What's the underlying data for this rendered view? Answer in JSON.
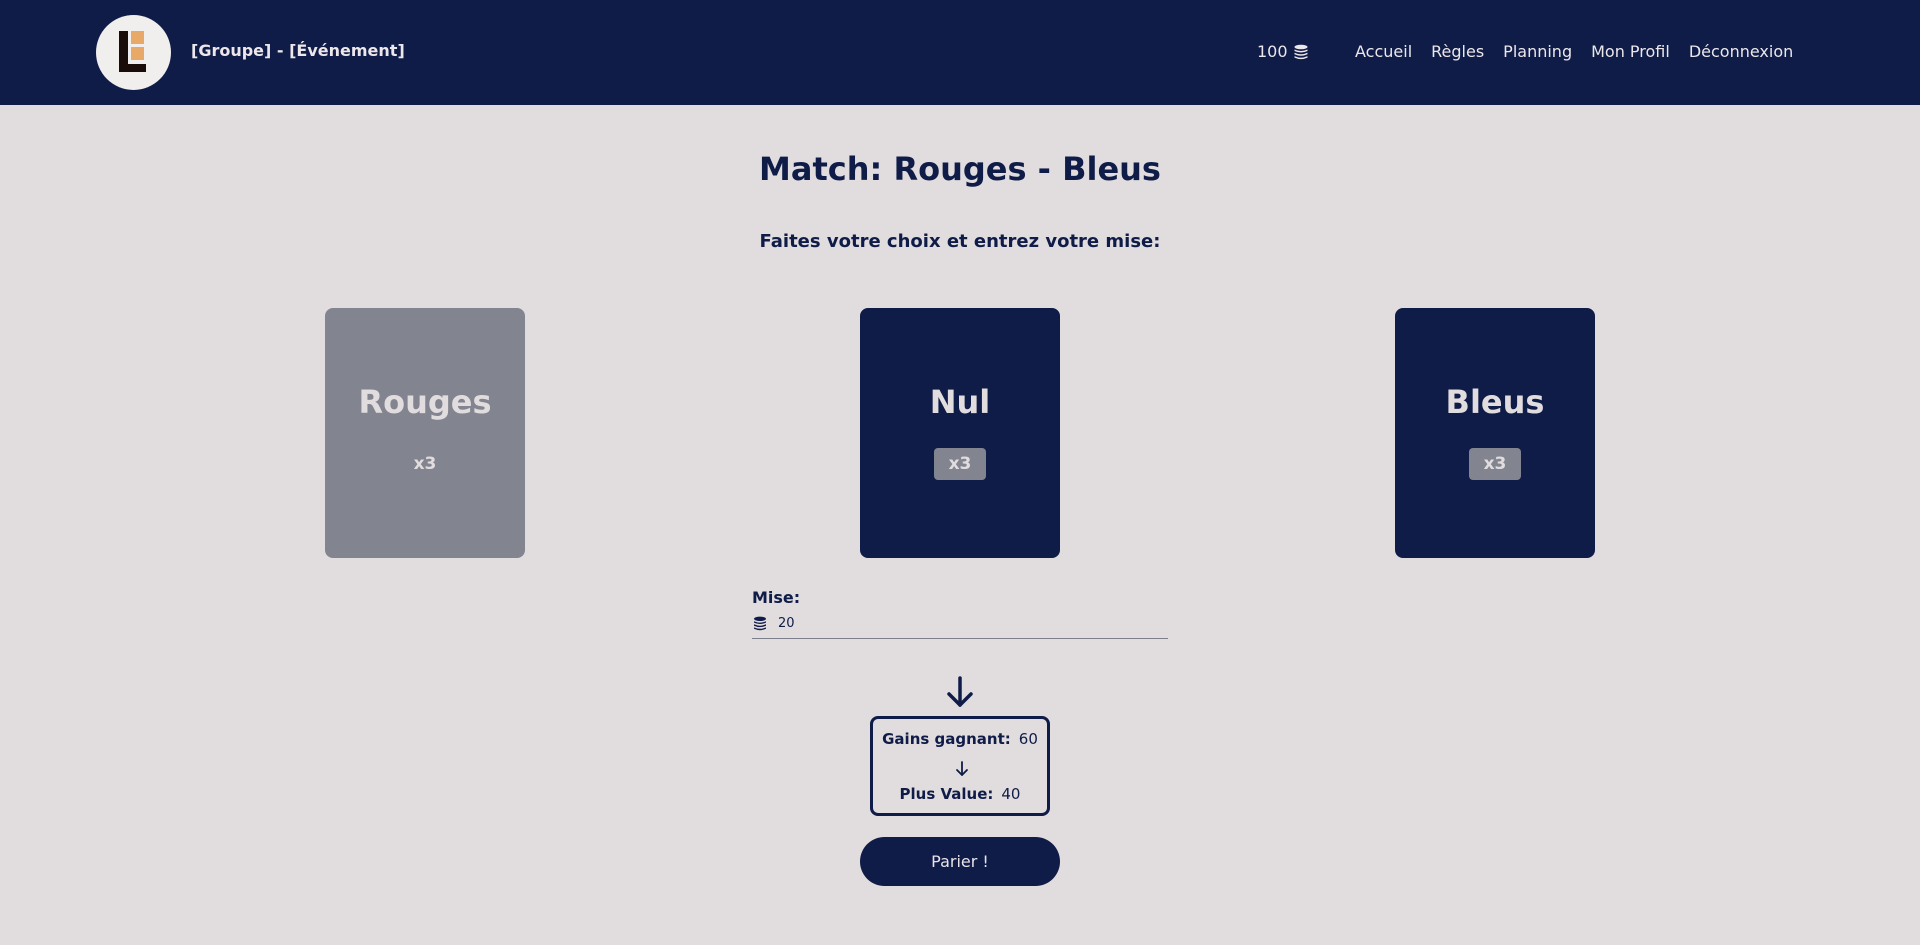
{
  "header": {
    "title": "[Groupe] - [Événement]",
    "logo_icon": "logo-icon",
    "wallet": {
      "amount": "100",
      "icon": "coins-icon"
    },
    "nav": [
      {
        "label": "Accueil"
      },
      {
        "label": "Règles"
      },
      {
        "label": "Planning"
      },
      {
        "label": "Mon Profil"
      },
      {
        "label": "Déconnexion"
      }
    ]
  },
  "main": {
    "title": "Match: Rouges - Bleus",
    "subtitle": "Faites votre choix et entrez votre mise:",
    "choices": [
      {
        "name": "Rouges",
        "odds": "x3",
        "selected": true
      },
      {
        "name": "Nul",
        "odds": "x3",
        "selected": false
      },
      {
        "name": "Bleus",
        "odds": "x3",
        "selected": false
      }
    ],
    "stake": {
      "label": "Mise:",
      "value": "20",
      "icon": "coins-icon"
    },
    "result": {
      "gains_label": "Gains gagnant:",
      "gains_value": "60",
      "plus_value_label": "Plus Value:",
      "plus_value_value": "40"
    },
    "submit_label": "Parier !"
  },
  "colors": {
    "primary": "#0f1c48",
    "background": "#e1dcde",
    "selected_card": "#82848f",
    "logo_accent": "#e8a867"
  }
}
